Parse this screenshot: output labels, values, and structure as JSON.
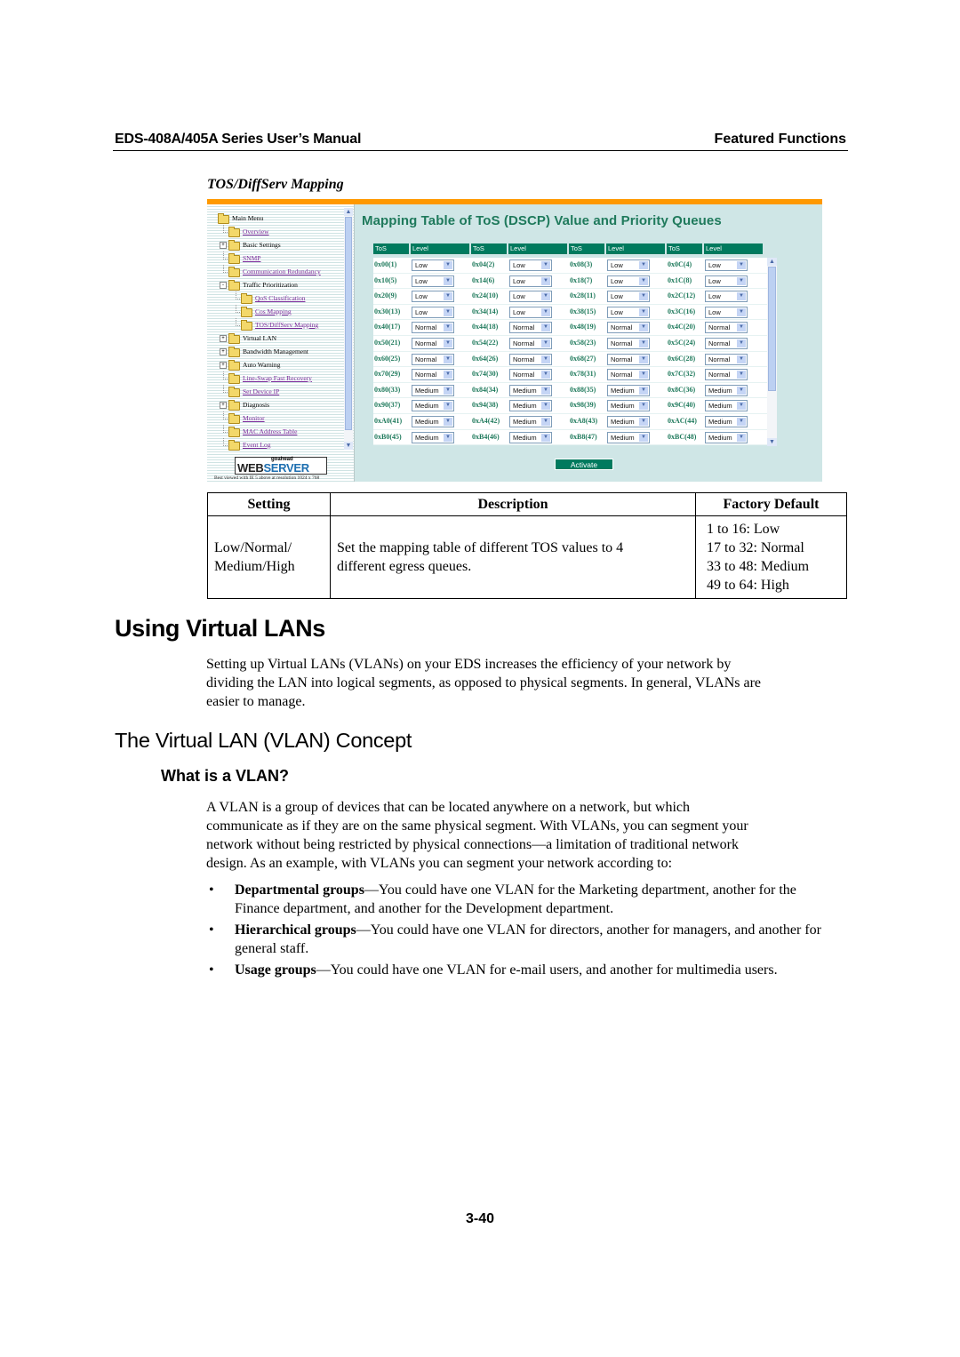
{
  "header": {
    "manual_title": "EDS-408A/405A Series User’s Manual",
    "section": "Featured Functions"
  },
  "figure_title": "TOS/DiffServ Mapping",
  "web_ui": {
    "accent_color": "#ff9900",
    "brand_color": "#007a5e",
    "sidebar": {
      "items": [
        {
          "label": "Main Menu",
          "level": 0,
          "link": false,
          "expander": "open"
        },
        {
          "label": "Overview",
          "level": 1,
          "link": true,
          "expander": ""
        },
        {
          "label": "Basic Settings",
          "level": 1,
          "link": false,
          "expander": "+"
        },
        {
          "label": "SNMP",
          "level": 1,
          "link": true,
          "expander": ""
        },
        {
          "label": "Communication Redundancy",
          "level": 1,
          "link": true,
          "expander": ""
        },
        {
          "label": "Traffic Prioritization",
          "level": 1,
          "link": false,
          "expander": "-"
        },
        {
          "label": "QoS Classification",
          "level": 2,
          "link": true,
          "expander": ""
        },
        {
          "label": "Cos Mapping",
          "level": 2,
          "link": true,
          "expander": ""
        },
        {
          "label": "TOS/DiffServ Mapping",
          "level": 2,
          "link": true,
          "expander": ""
        },
        {
          "label": "Virtual LAN",
          "level": 1,
          "link": false,
          "expander": "+"
        },
        {
          "label": "Bandwidth Management",
          "level": 1,
          "link": false,
          "expander": "+"
        },
        {
          "label": "Auto Warning",
          "level": 1,
          "link": false,
          "expander": "+"
        },
        {
          "label": "Line-Swap Fast Recovery",
          "level": 1,
          "link": true,
          "expander": ""
        },
        {
          "label": "Set Device IP",
          "level": 1,
          "link": true,
          "expander": ""
        },
        {
          "label": "Diagnosis",
          "level": 1,
          "link": false,
          "expander": "+"
        },
        {
          "label": "Monitor",
          "level": 1,
          "link": true,
          "expander": ""
        },
        {
          "label": "MAC Address Table",
          "level": 1,
          "link": true,
          "expander": ""
        },
        {
          "label": "Event Log",
          "level": 1,
          "link": true,
          "expander": ""
        }
      ],
      "logo_small": "goahead",
      "logo_web": "WEB",
      "logo_server": "SERVER",
      "best_viewed": "Best viewed with IE 5 above at resolution 1024 x 768"
    },
    "title": "Mapping Table of ToS (DSCP) Value and Priority Queues",
    "columns": [
      "ToS",
      "Level",
      "ToS",
      "Level",
      "ToS",
      "Level",
      "ToS",
      "Level"
    ],
    "rows": [
      [
        [
          "0x00(1)",
          "Low"
        ],
        [
          "0x04(2)",
          "Low"
        ],
        [
          "0x08(3)",
          "Low"
        ],
        [
          "0x0C(4)",
          "Low"
        ]
      ],
      [
        [
          "0x10(5)",
          "Low"
        ],
        [
          "0x14(6)",
          "Low"
        ],
        [
          "0x18(7)",
          "Low"
        ],
        [
          "0x1C(8)",
          "Low"
        ]
      ],
      [
        [
          "0x20(9)",
          "Low"
        ],
        [
          "0x24(10)",
          "Low"
        ],
        [
          "0x28(11)",
          "Low"
        ],
        [
          "0x2C(12)",
          "Low"
        ]
      ],
      [
        [
          "0x30(13)",
          "Low"
        ],
        [
          "0x34(14)",
          "Low"
        ],
        [
          "0x38(15)",
          "Low"
        ],
        [
          "0x3C(16)",
          "Low"
        ]
      ],
      [
        [
          "0x40(17)",
          "Normal"
        ],
        [
          "0x44(18)",
          "Normal"
        ],
        [
          "0x48(19)",
          "Normal"
        ],
        [
          "0x4C(20)",
          "Normal"
        ]
      ],
      [
        [
          "0x50(21)",
          "Normal"
        ],
        [
          "0x54(22)",
          "Normal"
        ],
        [
          "0x58(23)",
          "Normal"
        ],
        [
          "0x5C(24)",
          "Normal"
        ]
      ],
      [
        [
          "0x60(25)",
          "Normal"
        ],
        [
          "0x64(26)",
          "Normal"
        ],
        [
          "0x68(27)",
          "Normal"
        ],
        [
          "0x6C(28)",
          "Normal"
        ]
      ],
      [
        [
          "0x70(29)",
          "Normal"
        ],
        [
          "0x74(30)",
          "Normal"
        ],
        [
          "0x78(31)",
          "Normal"
        ],
        [
          "0x7C(32)",
          "Normal"
        ]
      ],
      [
        [
          "0x80(33)",
          "Medium"
        ],
        [
          "0x84(34)",
          "Medium"
        ],
        [
          "0x88(35)",
          "Medium"
        ],
        [
          "0x8C(36)",
          "Medium"
        ]
      ],
      [
        [
          "0x90(37)",
          "Medium"
        ],
        [
          "0x94(38)",
          "Medium"
        ],
        [
          "0x98(39)",
          "Medium"
        ],
        [
          "0x9C(40)",
          "Medium"
        ]
      ],
      [
        [
          "0xA0(41)",
          "Medium"
        ],
        [
          "0xA4(42)",
          "Medium"
        ],
        [
          "0xA8(43)",
          "Medium"
        ],
        [
          "0xAC(44)",
          "Medium"
        ]
      ],
      [
        [
          "0xB0(45)",
          "Medium"
        ],
        [
          "0xB4(46)",
          "Medium"
        ],
        [
          "0xB8(47)",
          "Medium"
        ],
        [
          "0xBC(48)",
          "Medium"
        ]
      ]
    ],
    "activate_label": "Activate"
  },
  "settings_table": {
    "headers": [
      "Setting",
      "Description",
      "Factory Default"
    ],
    "setting_lines": [
      "Low/Normal/",
      "Medium/High"
    ],
    "description_lines": [
      "Set the mapping table of different TOS values to 4",
      "different egress queues."
    ],
    "defaults": [
      "1 to 16: Low",
      "17 to 32: Normal",
      "33 to 48: Medium",
      "49 to 64: High"
    ]
  },
  "section_heading": "Using Virtual LANs",
  "intro_paragraph_lines": [
    "Setting up Virtual LANs (VLANs) on your EDS increases the efficiency of your network by",
    "dividing the LAN into logical segments, as opposed to physical segments. In general, VLANs are",
    "easier to manage."
  ],
  "subsection_heading": "The Virtual LAN (VLAN) Concept",
  "subsubsection_heading": "What is a VLAN?",
  "vlan_paragraph_lines": [
    "A VLAN is a group of devices that can be located anywhere on a network, but which",
    "communicate as if they are on the same physical segment. With VLANs, you can segment your",
    "network without being restricted by physical connections—a limitation of traditional network",
    "design. As an example, with VLANs you can segment your network according to:"
  ],
  "bullets": [
    {
      "bold": "Departmental groups",
      "text": "—You could have one VLAN for the Marketing department, another for the Finance department, and another for the Development department."
    },
    {
      "bold": "Hierarchical groups",
      "text": "—You could have one VLAN for directors, another for managers, and another for general staff."
    },
    {
      "bold": "Usage groups",
      "text": "—You could have one VLAN for e-mail users, and another for multimedia users."
    }
  ],
  "bullet_glyph": "•",
  "page_number": "3-40"
}
